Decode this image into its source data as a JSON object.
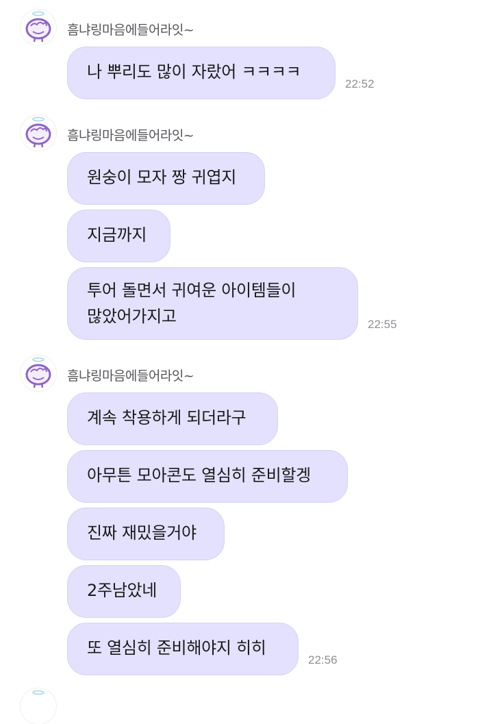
{
  "groups": [
    {
      "sender": "흠냐링마음에들어라잇~",
      "messages": [
        "나 뿌리도 많이 자랐어 ㅋㅋㅋㅋ"
      ],
      "time": "22:52"
    },
    {
      "sender": "흠냐링마음에들어라잇~",
      "messages": [
        "원숭이 모자 짱 귀엽지",
        "지금까지",
        "투어 돌면서 귀여운 아이템들이",
        "많았어가지고"
      ],
      "time": "22:55"
    },
    {
      "sender": "흠냐링마음에들어라잇~",
      "messages": [
        "계속 착용하게 되더라구",
        "아무튼 모아콘도 열심히 준비할겡",
        "진짜 재밌을거야",
        "2주남았네",
        "또 열심히 준비해야지 히히"
      ],
      "time": "22:56"
    }
  ],
  "colors": {
    "bubble": "#e3e1fd",
    "bubble_border": "#d5d2f4",
    "avatar_stroke": "#8e63c9",
    "timestamp": "#8e8e96"
  },
  "icons": {
    "avatar": "cartoon-face-avatar-icon"
  }
}
